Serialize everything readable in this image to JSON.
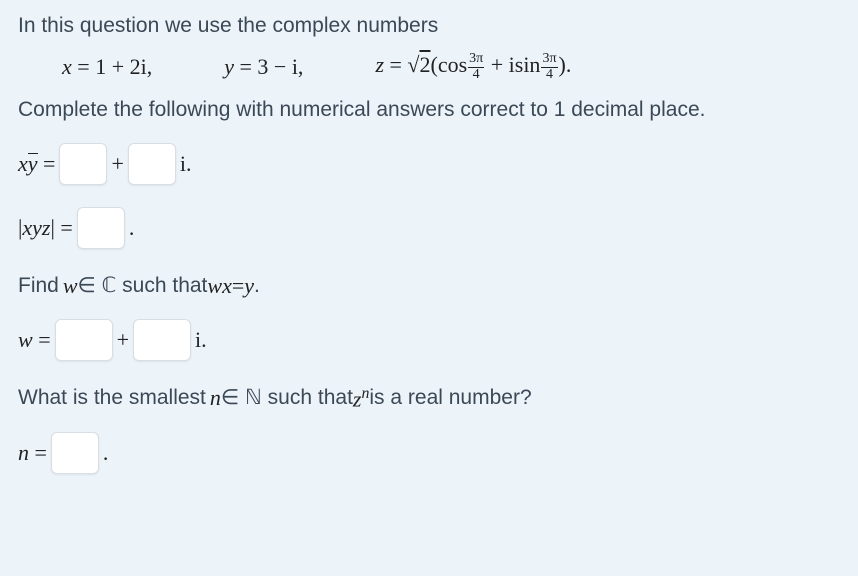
{
  "intro": "In this question we use the complex numbers",
  "defs": {
    "x_lhs": "x",
    "x_rhs": "1 + 2i,",
    "y_lhs": "y",
    "y_rhs": "3 − i,",
    "z_lhs": "z",
    "z_sqrt": "2",
    "z_cos": "cos",
    "z_sin": "isin",
    "frac_num": "3π",
    "frac_den": "4",
    "z_close": ")."
  },
  "instr1": "Complete the following with numerical answers correct to 1 decimal place.",
  "line_xy": {
    "lhs_x": "x",
    "lhs_ybar": "y",
    "eq": " = ",
    "plus": " + ",
    "tail": "i."
  },
  "line_abs": {
    "label": "|xyz|",
    "eq": " = ",
    "tail": "."
  },
  "instr2_a": "Find ",
  "instr2_w": "w",
  "instr2_b": " ∈ ℂ such that ",
  "instr2_wx": "wx",
  "instr2_c": " = ",
  "instr2_y": "y",
  "instr2_d": ".",
  "line_w": {
    "lhs": "w",
    "eq": " = ",
    "plus": " + ",
    "tail": "i."
  },
  "instr3_a": "What is the smallest ",
  "instr3_n": "n",
  "instr3_b": " ∈ ℕ such that ",
  "instr3_z": "z",
  "instr3_sup": "n",
  "instr3_c": " is a real number?",
  "line_n": {
    "lhs": "n",
    "eq": " = ",
    "tail": "."
  }
}
